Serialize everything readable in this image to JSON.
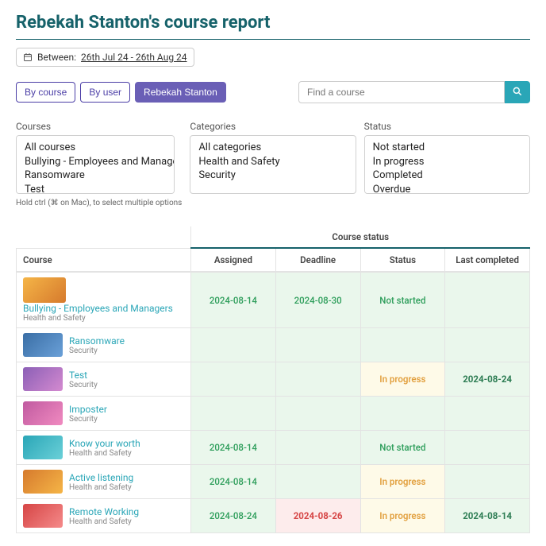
{
  "title": "Rebekah Stanton's course report",
  "dateRange": {
    "label": "Between:",
    "value": "26th Jul 24 - 26th Aug 24"
  },
  "tabs": {
    "byCourse": "By course",
    "byUser": "By user",
    "active": "Rebekah Stanton"
  },
  "search": {
    "placeholder": "Find a course"
  },
  "filters": {
    "courses": {
      "label": "Courses",
      "options": [
        "All courses",
        "Bullying - Employees and Managers",
        "Ransomware",
        "Test"
      ]
    },
    "categories": {
      "label": "Categories",
      "options": [
        "All categories",
        "Health and Safety",
        "Security"
      ]
    },
    "status": {
      "label": "Status",
      "options": [
        "Not started",
        "In progress",
        "Completed",
        "Overdue"
      ]
    }
  },
  "helpText": "Hold ctrl (⌘ on Mac), to select multiple options",
  "table": {
    "groupHeader": "Course status",
    "cols": {
      "course": "Course",
      "assigned": "Assigned",
      "deadline": "Deadline",
      "status": "Status",
      "lastCompleted": "Last completed"
    },
    "rows": [
      {
        "name": "Bullying - Employees and Managers",
        "cat": "Health and Safety",
        "assigned": "2024-08-14",
        "deadline": "2024-08-30",
        "status": "Not started",
        "statusKind": "green",
        "last": "",
        "bigThumb": true
      },
      {
        "name": "Ransomware",
        "cat": "Security",
        "assigned": "",
        "deadline": "",
        "status": "",
        "statusKind": "green",
        "last": ""
      },
      {
        "name": "Test",
        "cat": "Security",
        "assigned": "",
        "deadline": "",
        "status": "In progress",
        "statusKind": "yellow",
        "last": "2024-08-24"
      },
      {
        "name": "Imposter",
        "cat": "Security",
        "assigned": "",
        "deadline": "",
        "status": "",
        "statusKind": "green",
        "last": ""
      },
      {
        "name": "Know your worth",
        "cat": "Health and Safety",
        "assigned": "2024-08-14",
        "deadline": "",
        "status": "Not started",
        "statusKind": "green",
        "last": ""
      },
      {
        "name": "Active listening",
        "cat": "Health and Safety",
        "assigned": "2024-08-14",
        "deadline": "",
        "status": "In progress",
        "statusKind": "yellow",
        "last": ""
      },
      {
        "name": "Remote Working",
        "cat": "Health and Safety",
        "assigned": "2024-08-24",
        "deadline": "2024-08-26",
        "deadlineKind": "red",
        "status": "In progress",
        "statusKind": "yellow",
        "last": "2024-08-14"
      }
    ]
  }
}
